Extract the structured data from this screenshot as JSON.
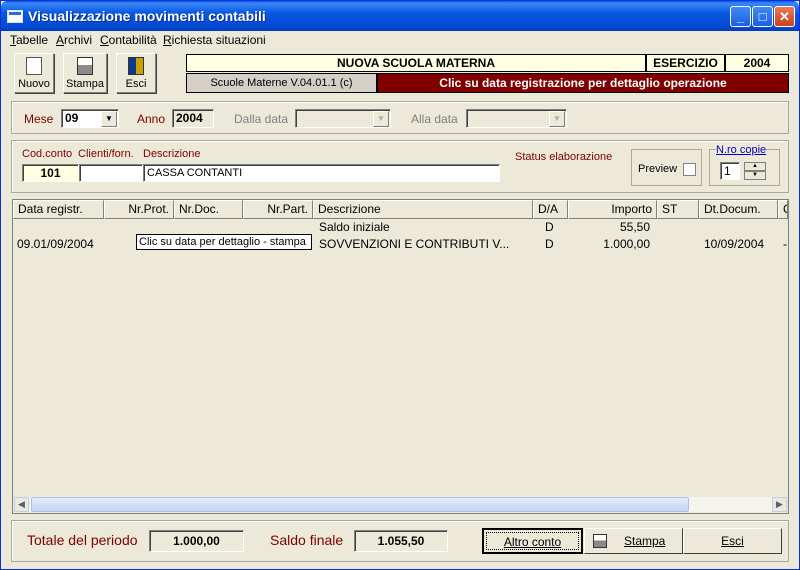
{
  "window": {
    "title": "Visualizzazione movimenti contabili",
    "controls": {
      "minimize": "_",
      "maximize": "□",
      "close": "✕"
    }
  },
  "menu": [
    "Tabelle",
    "Archivi",
    "Contabilità",
    "Richiesta situazioni"
  ],
  "toolbar": {
    "new_label": "Nuovo",
    "print_label": "Stampa",
    "exit_label": "Esci"
  },
  "header": {
    "school": "NUOVA SCUOLA MATERNA",
    "exercise_label": "ESERCIZIO",
    "exercise_value": "2004",
    "version": "Scuole Materne V.04.01.1 (c)",
    "hint": "Clic su data registrazione per dettaglio operazione"
  },
  "filters": {
    "month_label": "Mese",
    "month_value": "09",
    "year_label": "Anno",
    "year_value": "2004",
    "from_label": "Dalla data",
    "to_label": "Alla data",
    "arrow": "▼"
  },
  "account": {
    "code_label": "Cod.conto",
    "client_label": "Clienti/forn.",
    "desc_label": "Descrizione",
    "code_value": "101",
    "client_value": "",
    "desc_value": "CASSA CONTANTI",
    "status_label": "Status elaborazione",
    "preview_label": "Preview",
    "copies_label": "N.ro copie",
    "copies_value": "1",
    "spin_up": "▲",
    "spin_down": "▼"
  },
  "table": {
    "columns": [
      "Data registr.",
      "Nr.Prot.",
      "Nr.Doc.",
      "Nr.Part.",
      "Descrizione",
      "D/A",
      "Importo",
      "ST",
      "Dt.Docum.",
      "C"
    ],
    "rows": [
      {
        "date": "",
        "prot": "",
        "doc": "",
        "part": "",
        "desc": "Saldo iniziale",
        "da": "D",
        "amount": "55,50",
        "st": "",
        "docdate": "",
        "c": ""
      },
      {
        "date": "09.01/09/2004",
        "prot": "",
        "doc": "",
        "part": "",
        "desc": "SOVVENZIONI E CONTRIBUTI V...",
        "da": "D",
        "amount": "1.000,00",
        "st": "",
        "docdate": "10/09/2004",
        "c": "-"
      }
    ],
    "tooltip": "Clic su data per dettaglio  -  stampa",
    "scroll_left": "◀",
    "scroll_right": "▶"
  },
  "footer": {
    "period_total_label": "Totale del periodo",
    "period_total_value": "1.000,00",
    "final_balance_label": "Saldo finale",
    "final_balance_value": "1.055,50",
    "other_account_label": "Altro conto",
    "print_label": "Stampa",
    "exit_label": "Esci"
  }
}
